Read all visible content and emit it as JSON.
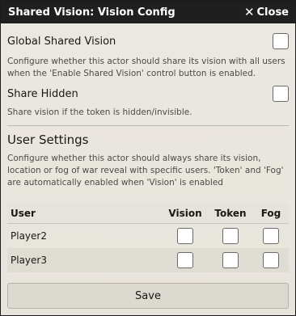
{
  "window": {
    "title": "Shared Vision: Vision Config",
    "close_label": "Close"
  },
  "settings": {
    "global": {
      "label": "Global Shared Vision",
      "note": "Configure whether this actor should share its vision with all users when the 'Enable Shared Vision' control button is enabled.",
      "checked": false
    },
    "hidden": {
      "label": "Share Hidden",
      "note": "Share vision if the token is hidden/invisible.",
      "checked": false
    }
  },
  "user_settings": {
    "title": "User Settings",
    "note": "Configure whether this actor should always share its vision, location or fog of war reveal with specific users. 'Token' and 'Fog' are automatically enabled when 'Vision' is enabled",
    "columns": [
      "User",
      "Vision",
      "Token",
      "Fog"
    ],
    "rows": [
      {
        "user": "Player2",
        "vision": false,
        "token": false,
        "fog": false
      },
      {
        "user": "Player3",
        "vision": false,
        "token": false,
        "fog": false
      }
    ]
  },
  "save_label": "Save"
}
